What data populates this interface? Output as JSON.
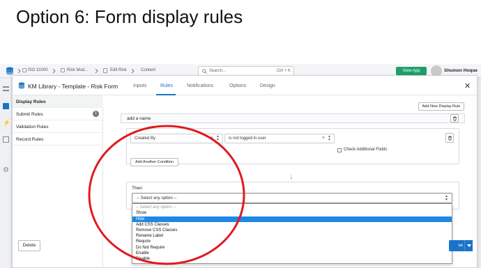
{
  "slide": {
    "title": "Option 6: Form display rules"
  },
  "topbar": {
    "breadcrumbs": [
      "ISO 31000",
      "Risk Mod...",
      "Edit Risk",
      "Content"
    ],
    "search_placeholder": "Search...",
    "search_shortcut": "Ctrl + K",
    "view_app": "View App",
    "user_name": "Shumon Hoque"
  },
  "modal": {
    "title": "KM Library - Template - Risk Form",
    "tabs": [
      "Inputs",
      "Rules",
      "Notifications",
      "Options",
      "Design"
    ],
    "active_tab": "Rules",
    "close": "✕"
  },
  "sidebar": {
    "items": [
      {
        "label": "Display Rules",
        "active": true
      },
      {
        "label": "Submit Rules",
        "badge": "1"
      },
      {
        "label": "Validation Rules"
      },
      {
        "label": "Record Rules"
      }
    ],
    "delete_label": "Delete"
  },
  "rules": {
    "add_rule_label": "Add New Display Rule",
    "rule_name": "add a name",
    "condition": {
      "field": "Created By",
      "operator": "is not logged in user",
      "check_additional_label": "Check Additional Fields",
      "add_condition_label": "Add Another Condition"
    },
    "then": {
      "label": "Then",
      "select_value": "-- Select any option --",
      "options": [
        "-- Select any option --",
        "Show",
        "Hide",
        "Add CSS Classes",
        "Remove CSS Classes",
        "Rename Label",
        "Require",
        "Do Not Require",
        "Enable",
        "Disable"
      ],
      "highlighted_option": "Hide"
    }
  },
  "footer": {
    "save_partial": "ve"
  },
  "colors": {
    "accent": "#1a73c8",
    "highlight": "#1e88e5",
    "view_app": "#1e9e6a",
    "annotation_circle": "#e0191f"
  }
}
